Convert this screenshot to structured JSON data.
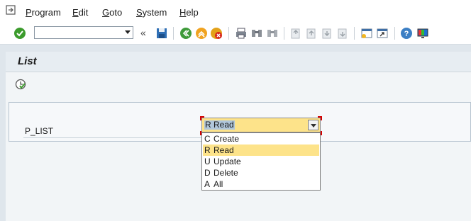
{
  "menu": {
    "items": [
      "Program",
      "Edit",
      "Goto",
      "System",
      "Help"
    ]
  },
  "toolbar": {
    "command_field_value": "",
    "history_glyph": "«"
  },
  "screen": {
    "title": "List"
  },
  "selection": {
    "parameter_label": "P_LIST",
    "current_value": "R Read",
    "options": [
      {
        "key": "C",
        "text": "Create"
      },
      {
        "key": "R",
        "text": "Read"
      },
      {
        "key": "U",
        "text": "Update"
      },
      {
        "key": "D",
        "text": "Delete"
      },
      {
        "key": "A",
        "text": "All"
      }
    ],
    "highlighted_index": 1
  },
  "colors": {
    "input_highlight": "#fde38a",
    "title_bg": "#e7edf2",
    "selection_marker": "#d40000"
  },
  "icons": [
    "menu-icon",
    "enter-check-icon",
    "save-icon",
    "back-icon",
    "exit-icon",
    "cancel-icon",
    "print-icon",
    "find-icon",
    "find-next-icon",
    "first-page-icon",
    "previous-page-icon",
    "next-page-icon",
    "last-page-icon",
    "new-session-icon",
    "shortcut-icon",
    "help-icon",
    "customize-layout-icon",
    "execute-icon"
  ]
}
